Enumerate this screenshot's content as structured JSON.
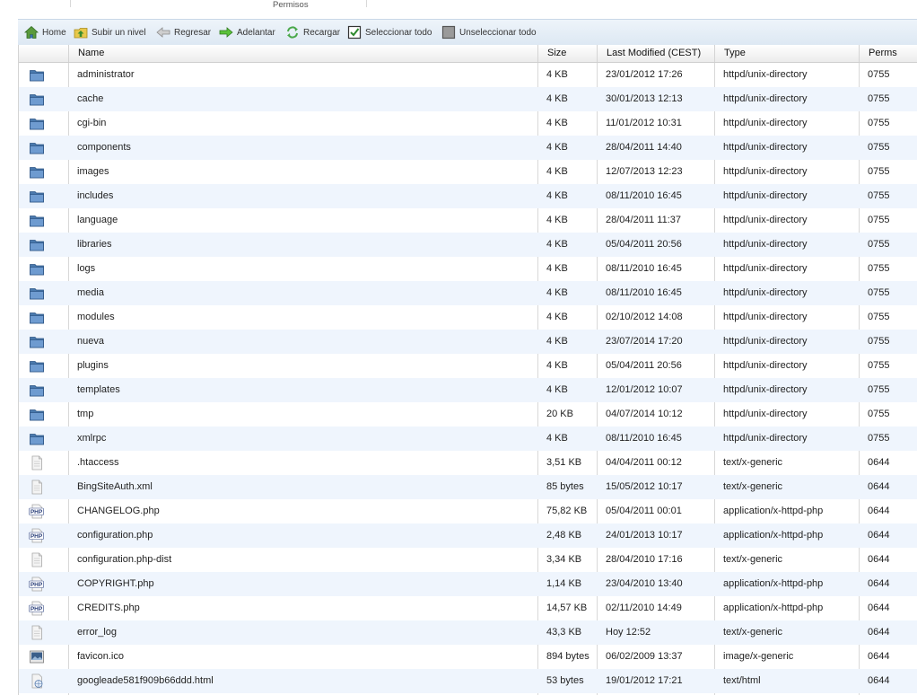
{
  "tab": {
    "label": "Permisos"
  },
  "toolbar": {
    "home": "Home",
    "up": "Subir un nivel",
    "back": "Regresar",
    "forward": "Adelantar",
    "reload": "Recargar",
    "select_all": "Seleccionar todo",
    "unselect_all": "Unseleccionar todo"
  },
  "columns": {
    "name": "Name",
    "size": "Size",
    "modified": "Last Modified (CEST)",
    "type": "Type",
    "perms": "Perms"
  },
  "rows": [
    {
      "icon": "folder-icon",
      "name": "administrator",
      "size": "4 KB",
      "modified": "23/01/2012 17:26",
      "type": "httpd/unix-directory",
      "perms": "0755"
    },
    {
      "icon": "folder-icon",
      "name": "cache",
      "size": "4 KB",
      "modified": "30/01/2013 12:13",
      "type": "httpd/unix-directory",
      "perms": "0755"
    },
    {
      "icon": "folder-icon",
      "name": "cgi-bin",
      "size": "4 KB",
      "modified": "11/01/2012 10:31",
      "type": "httpd/unix-directory",
      "perms": "0755"
    },
    {
      "icon": "folder-icon",
      "name": "components",
      "size": "4 KB",
      "modified": "28/04/2011 14:40",
      "type": "httpd/unix-directory",
      "perms": "0755"
    },
    {
      "icon": "folder-icon",
      "name": "images",
      "size": "4 KB",
      "modified": "12/07/2013 12:23",
      "type": "httpd/unix-directory",
      "perms": "0755"
    },
    {
      "icon": "folder-icon",
      "name": "includes",
      "size": "4 KB",
      "modified": "08/11/2010 16:45",
      "type": "httpd/unix-directory",
      "perms": "0755"
    },
    {
      "icon": "folder-icon",
      "name": "language",
      "size": "4 KB",
      "modified": "28/04/2011 11:37",
      "type": "httpd/unix-directory",
      "perms": "0755"
    },
    {
      "icon": "folder-icon",
      "name": "libraries",
      "size": "4 KB",
      "modified": "05/04/2011 20:56",
      "type": "httpd/unix-directory",
      "perms": "0755"
    },
    {
      "icon": "folder-icon",
      "name": "logs",
      "size": "4 KB",
      "modified": "08/11/2010 16:45",
      "type": "httpd/unix-directory",
      "perms": "0755"
    },
    {
      "icon": "folder-icon",
      "name": "media",
      "size": "4 KB",
      "modified": "08/11/2010 16:45",
      "type": "httpd/unix-directory",
      "perms": "0755"
    },
    {
      "icon": "folder-icon",
      "name": "modules",
      "size": "4 KB",
      "modified": "02/10/2012 14:08",
      "type": "httpd/unix-directory",
      "perms": "0755"
    },
    {
      "icon": "folder-icon",
      "name": "nueva",
      "size": "4 KB",
      "modified": "23/07/2014 17:20",
      "type": "httpd/unix-directory",
      "perms": "0755"
    },
    {
      "icon": "folder-icon",
      "name": "plugins",
      "size": "4 KB",
      "modified": "05/04/2011 20:56",
      "type": "httpd/unix-directory",
      "perms": "0755"
    },
    {
      "icon": "folder-icon",
      "name": "templates",
      "size": "4 KB",
      "modified": "12/01/2012 10:07",
      "type": "httpd/unix-directory",
      "perms": "0755"
    },
    {
      "icon": "folder-icon",
      "name": "tmp",
      "size": "20 KB",
      "modified": "04/07/2014 10:12",
      "type": "httpd/unix-directory",
      "perms": "0755"
    },
    {
      "icon": "folder-icon",
      "name": "xmlrpc",
      "size": "4 KB",
      "modified": "08/11/2010 16:45",
      "type": "httpd/unix-directory",
      "perms": "0755"
    },
    {
      "icon": "generic-file-icon",
      "name": ".htaccess",
      "size": "3,51 KB",
      "modified": "04/04/2011 00:12",
      "type": "text/x-generic",
      "perms": "0644"
    },
    {
      "icon": "generic-file-icon",
      "name": "BingSiteAuth.xml",
      "size": "85 bytes",
      "modified": "15/05/2012 10:17",
      "type": "text/x-generic",
      "perms": "0644"
    },
    {
      "icon": "php-file-icon",
      "name": "CHANGELOG.php",
      "size": "75,82 KB",
      "modified": "05/04/2011 00:01",
      "type": "application/x-httpd-php",
      "perms": "0644"
    },
    {
      "icon": "php-file-icon",
      "name": "configuration.php",
      "size": "2,48 KB",
      "modified": "24/01/2013 10:17",
      "type": "application/x-httpd-php",
      "perms": "0644"
    },
    {
      "icon": "generic-file-icon",
      "name": "configuration.php-dist",
      "size": "3,34 KB",
      "modified": "28/04/2010 17:16",
      "type": "text/x-generic",
      "perms": "0644"
    },
    {
      "icon": "php-file-icon",
      "name": "COPYRIGHT.php",
      "size": "1,14 KB",
      "modified": "23/04/2010 13:40",
      "type": "application/x-httpd-php",
      "perms": "0644"
    },
    {
      "icon": "php-file-icon",
      "name": "CREDITS.php",
      "size": "14,57 KB",
      "modified": "02/11/2010 14:49",
      "type": "application/x-httpd-php",
      "perms": "0644"
    },
    {
      "icon": "generic-file-icon",
      "name": "error_log",
      "size": "43,3 KB",
      "modified": "Hoy 12:52",
      "type": "text/x-generic",
      "perms": "0644"
    },
    {
      "icon": "image-file-icon",
      "name": "favicon.ico",
      "size": "894 bytes",
      "modified": "06/02/2009 13:37",
      "type": "image/x-generic",
      "perms": "0644"
    },
    {
      "icon": "html-file-icon",
      "name": "googleade581f909b66ddd.html",
      "size": "53 bytes",
      "modified": "19/01/2012 17:21",
      "type": "text/html",
      "perms": "0644"
    }
  ]
}
